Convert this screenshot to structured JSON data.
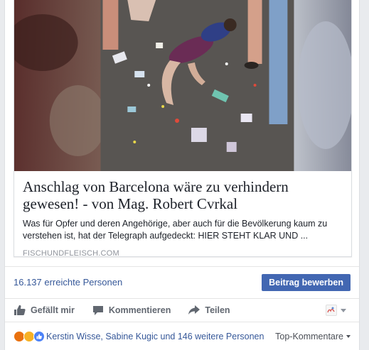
{
  "link": {
    "title": "Anschlag von Barcelona wäre zu verhindern gewesen! - von Mag. Robert Cvrkal",
    "description": "Was für Opfer und deren Angehörige, aber auch für die Bevölkerung kaum zu verstehen ist, hat der Telegraph aufgedeckt: HIER STEHT KLAR UND ...",
    "domain": "FISCHUNDFLEISCH.COM"
  },
  "stats": {
    "reach": "16.137 erreichte Personen",
    "boost_label": "Beitrag bewerben"
  },
  "actions": {
    "like": "Gefällt mir",
    "comment": "Kommentieren",
    "share": "Teilen"
  },
  "reactions": {
    "icons": [
      "angry-reaction-icon",
      "sad-reaction-icon",
      "like-reaction-icon"
    ],
    "summary": "Kerstin Wisse, Sabine Kugic und 146 weitere Personen",
    "sort_label": "Top-Kommentare"
  },
  "colors": {
    "link_blue": "#365899",
    "button_blue": "#4267b2",
    "muted": "#616770"
  }
}
